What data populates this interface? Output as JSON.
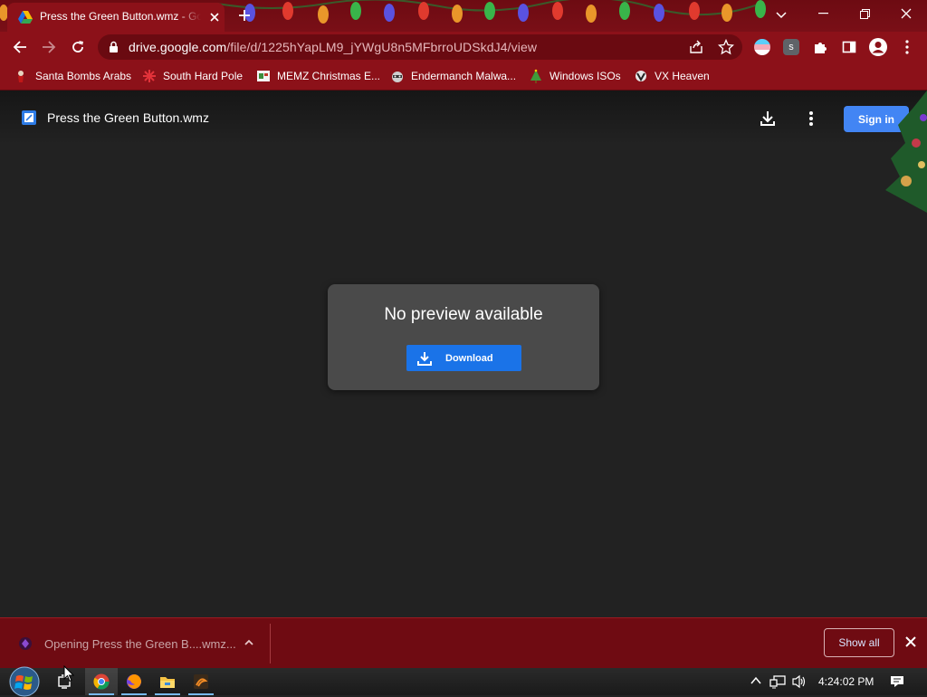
{
  "browser": {
    "tab": {
      "title": "Press the Green Button.wmz - Google Drive"
    },
    "address": {
      "host": "drive.google.com",
      "path": "/file/d/1225hYapLM9_jYWgU8n5MFbrroUDSkdJ4/view"
    },
    "extensions": [
      {
        "icon": "flag-extension-icon",
        "color": "#9ec7f0"
      },
      {
        "icon": "s-extension-icon",
        "label": "s",
        "color": "#5f6368"
      }
    ],
    "bookmarks": [
      {
        "label": "Santa Bombs Arabs",
        "icon": "santa-icon"
      },
      {
        "label": "South Hard Pole",
        "icon": "snowflake-icon"
      },
      {
        "label": "MEMZ Christmas E...",
        "icon": "memz-icon"
      },
      {
        "label": "Endermanch Malwa...",
        "icon": "raccoon-icon"
      },
      {
        "label": "Windows ISOs",
        "icon": "tree-icon"
      },
      {
        "label": "VX Heaven",
        "icon": "vx-icon"
      }
    ],
    "accent_color": "#8c1119"
  },
  "drive": {
    "file_name": "Press the Green Button.wmz",
    "sign_in_label": "Sign in",
    "preview": {
      "message": "No preview available",
      "download_label": "Download"
    },
    "brand_blue": "#1a73e8"
  },
  "download_shelf": {
    "item_text": "Opening Press the Green B....wmz...",
    "show_all_label": "Show all"
  },
  "taskbar": {
    "apps": [
      "task-view-icon",
      "chrome-icon",
      "firefox-icon",
      "file-explorer-icon",
      "app-icon"
    ],
    "clock": "4:24:02 PM"
  }
}
